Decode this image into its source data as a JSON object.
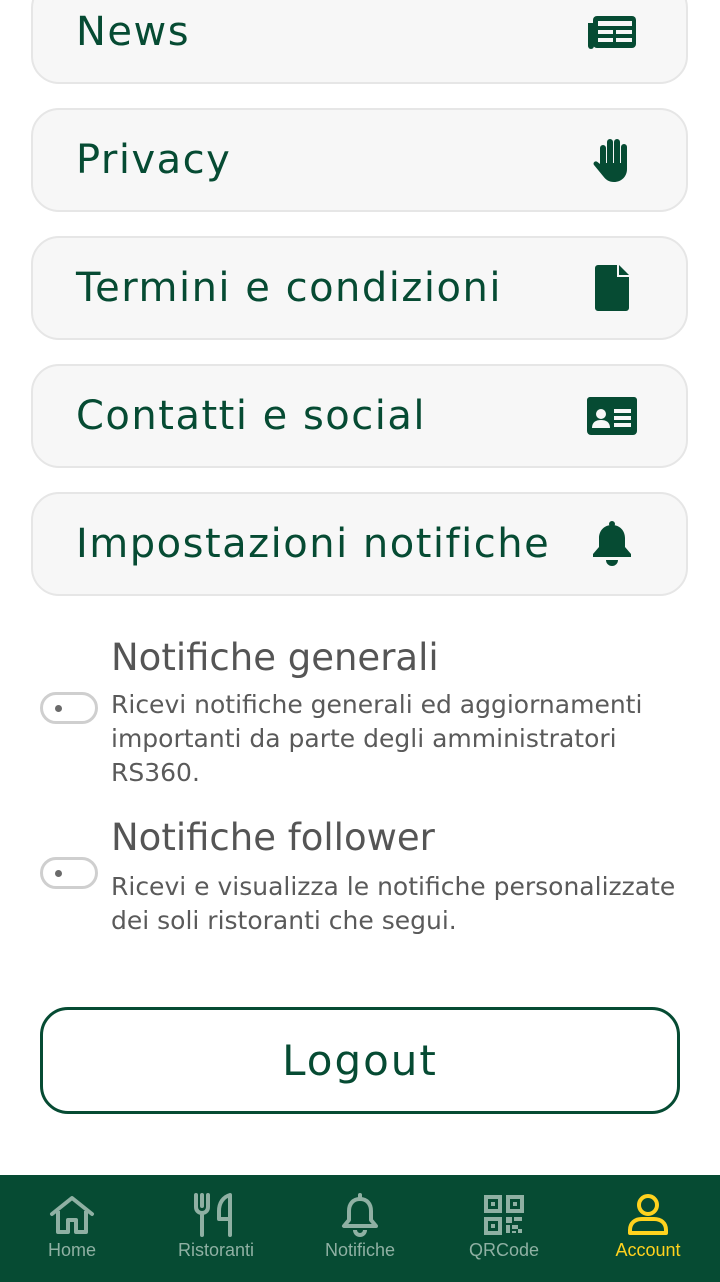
{
  "colors": {
    "brand_green": "#064b33",
    "card_bg": "#f7f7f7",
    "nav_inactive": "#8fb0a3",
    "nav_active": "#ffd21e"
  },
  "menu": {
    "items": [
      {
        "label": "News",
        "icon": "newspaper-icon"
      },
      {
        "label": "Privacy",
        "icon": "hand-icon"
      },
      {
        "label": "Termini e condizioni",
        "icon": "file-icon"
      },
      {
        "label": "Contatti e social",
        "icon": "id-card-icon"
      },
      {
        "label": "Impostazioni notifiche",
        "icon": "bell-icon"
      }
    ]
  },
  "notifications": {
    "general": {
      "title": "Notifiche generali",
      "description": "Ricevi notifiche generali ed aggiornamenti importanti da parte degli amministratori RS360."
    },
    "follower": {
      "title": "Notifiche follower",
      "description": "Ricevi e visualizza le notifiche personalizzate dei soli ristoranti che segui."
    }
  },
  "logout": {
    "label": "Logout"
  },
  "bottom_nav": {
    "items": [
      {
        "label": "Home",
        "icon": "home-icon"
      },
      {
        "label": "Ristoranti",
        "icon": "utensils-icon"
      },
      {
        "label": "Notifiche",
        "icon": "bell-outline-icon"
      },
      {
        "label": "QRCode",
        "icon": "qrcode-icon"
      },
      {
        "label": "Account",
        "icon": "user-icon",
        "active": true
      }
    ]
  }
}
